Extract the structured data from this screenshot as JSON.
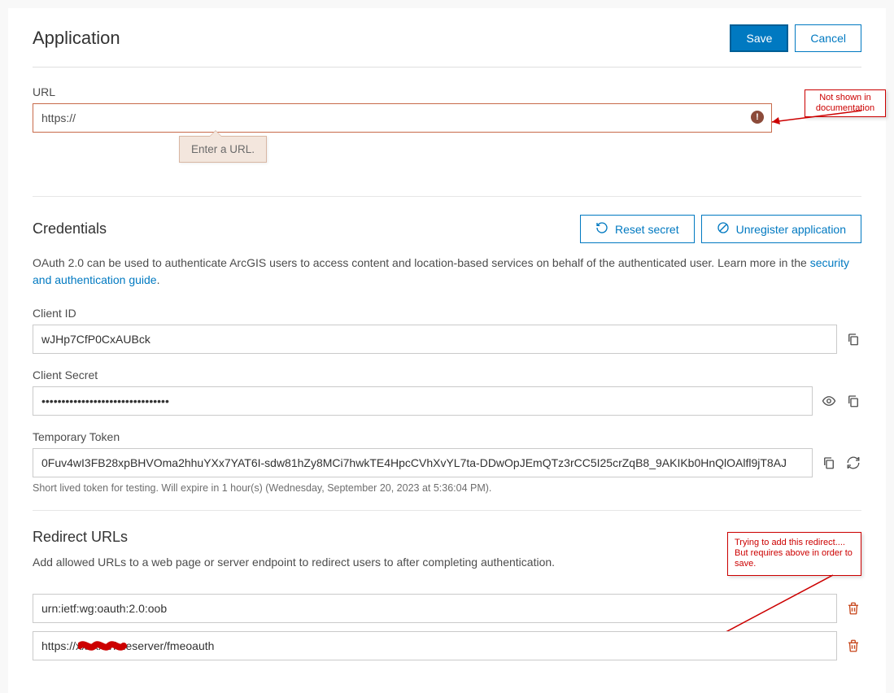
{
  "header": {
    "title": "Application",
    "save": "Save",
    "cancel": "Cancel"
  },
  "url_section": {
    "label": "URL",
    "value": "https://",
    "tooltip": "Enter a URL."
  },
  "annotations": {
    "top": "Not shown in documentation",
    "bottom": "Trying to add this redirect.... But requires above in order to save."
  },
  "credentials": {
    "title": "Credentials",
    "reset_secret": "Reset secret",
    "unregister": "Unregister application",
    "desc_prefix": "OAuth 2.0 can be used to authenticate ArcGIS users to access content and location-based services on behalf of the authenticated user. Learn more in the ",
    "desc_link": "security and authentication guide",
    "desc_suffix": ".",
    "client_id_label": "Client ID",
    "client_id_value": "wJHp7CfP0CxAUBck",
    "client_secret_label": "Client Secret",
    "client_secret_value": "••••••••••••••••••••••••••••••••",
    "temp_token_label": "Temporary Token",
    "temp_token_value": "0Fuv4wI3FB28xpBHVOma2hhuYXx7YAT6I-sdw81hZy8MCi7hwkTE4HpcCVhXvYL7ta-DDwOpJEmQTz3rCC5I25crZqB8_9AKIKb0HnQlOAlfl9jT8AJ",
    "temp_token_helper": "Short lived token for testing. Will expire in 1 hour(s) (Wednesday, September 20, 2023 at 5:36:04 PM)."
  },
  "redirects": {
    "title": "Redirect URLs",
    "desc": "Add allowed URLs to a web page or server endpoint to redirect users to after completing authentication.",
    "items": [
      "urn:ietf:wg:oauth:2.0:oob",
      "https://xxxxxx/fmeserver/fmeoauth"
    ]
  }
}
